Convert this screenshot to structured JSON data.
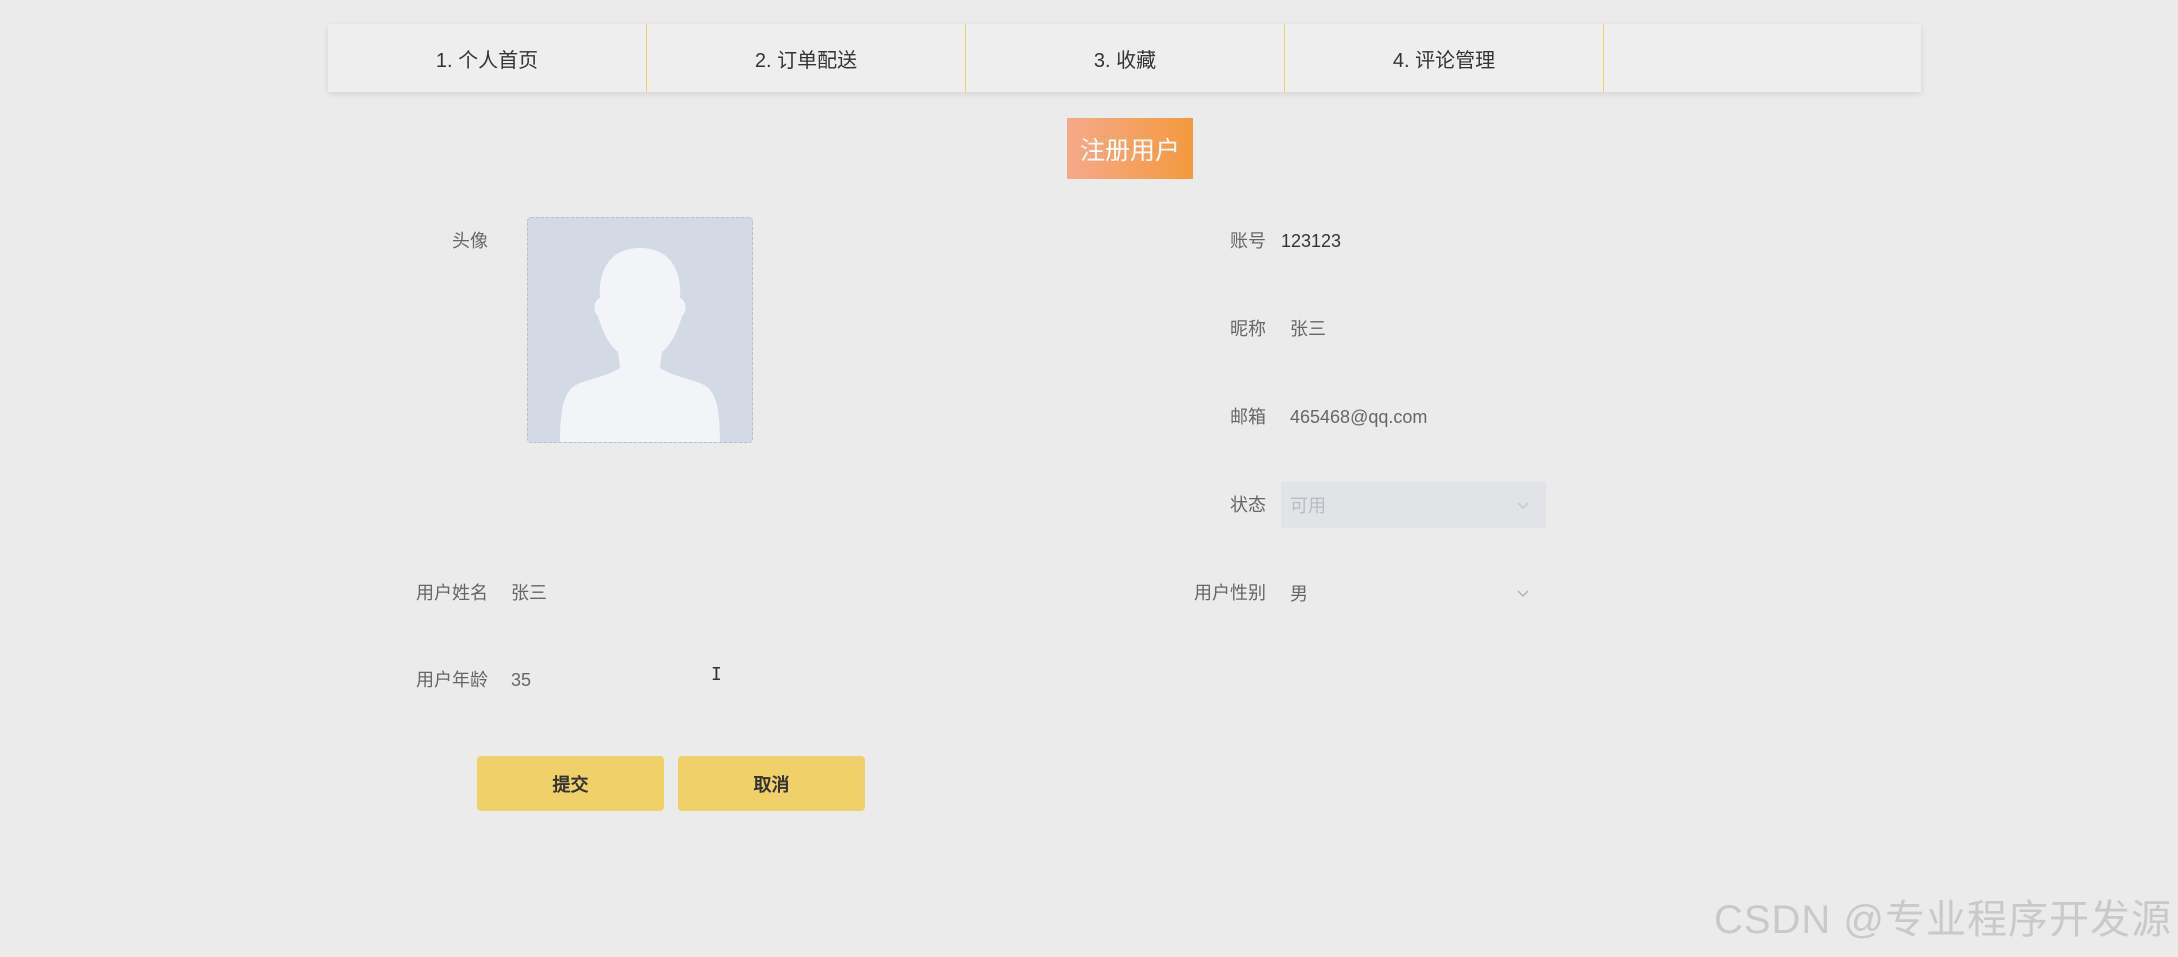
{
  "tabs": [
    {
      "label": "1. 个人首页"
    },
    {
      "label": "2. 订单配送"
    },
    {
      "label": "3. 收藏"
    },
    {
      "label": "4. 评论管理"
    }
  ],
  "page_title": "注册用户",
  "form": {
    "avatar": {
      "label": "头像",
      "icon": "user-silhouette-placeholder"
    },
    "account": {
      "label": "账号",
      "value": "123123"
    },
    "nickname": {
      "label": "昵称",
      "value": "张三"
    },
    "email": {
      "label": "邮箱",
      "value": "465468@qq.com"
    },
    "status": {
      "label": "状态",
      "value": "可用",
      "disabled": true
    },
    "real_name": {
      "label": "用户姓名",
      "value": "张三"
    },
    "gender": {
      "label": "用户性别",
      "value": "男"
    },
    "age": {
      "label": "用户年龄",
      "value": "35"
    }
  },
  "buttons": {
    "submit": "提交",
    "cancel": "取消"
  },
  "watermark": "CSDN @专业程序开发源",
  "colors": {
    "background": "#ebebeb",
    "tab_divider": "#f0cf6b",
    "title_gradient_start": "#f5a98a",
    "title_gradient_end": "#f39a3e",
    "button": "#f0d068",
    "avatar_bg": "#d3d9e5"
  }
}
